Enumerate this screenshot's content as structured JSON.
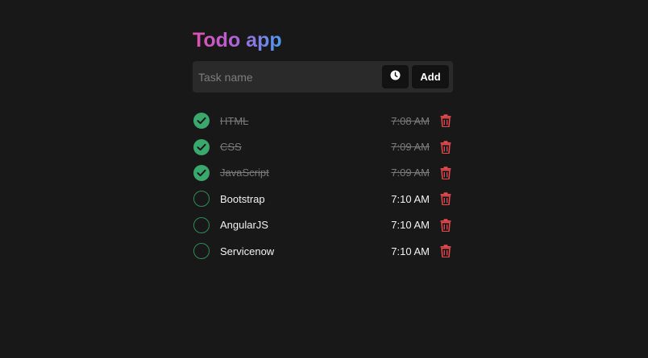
{
  "app": {
    "title": "Todo app"
  },
  "form": {
    "placeholder": "Task name",
    "value": "",
    "clock_icon": "clock-icon",
    "add_label": "Add"
  },
  "tasks": [
    {
      "name": "HTML",
      "time": "7:08 AM",
      "completed": true
    },
    {
      "name": "CSS",
      "time": "7:09 AM",
      "completed": true
    },
    {
      "name": "JavaScript",
      "time": "7:09 AM",
      "completed": true
    },
    {
      "name": "Bootstrap",
      "time": "7:10 AM",
      "completed": false
    },
    {
      "name": "AngularJS",
      "time": "7:10 AM",
      "completed": false
    },
    {
      "name": "Servicenow",
      "time": "7:10 AM",
      "completed": false
    }
  ],
  "icons": {
    "check": "check-circle-icon",
    "delete": "trash-icon"
  },
  "colors": {
    "background": "#181818",
    "input_bar": "#2a2a2a",
    "button": "#121212",
    "check_done": "#3aa76d",
    "check_border": "#2f8a58",
    "delete": "#e5484d",
    "title_gradient_start": "#e04fae",
    "title_gradient_end": "#4b9af1"
  }
}
